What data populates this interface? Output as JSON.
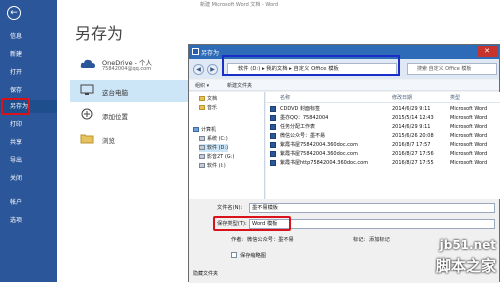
{
  "window_title": "新建 Microsoft Word 文档 - Word",
  "nav": {
    "back": "←",
    "items": [
      "信息",
      "新建",
      "打开",
      "保存",
      "另存为",
      "打印",
      "共享",
      "导出",
      "关闭",
      "帐户",
      "选项"
    ],
    "active": "另存为"
  },
  "page_title": "另存为",
  "places": [
    {
      "name": "OneDrive - 个人",
      "sub": "75842004@qq.com"
    },
    {
      "name": "这台电脑",
      "sub": ""
    },
    {
      "name": "添加位置",
      "sub": ""
    },
    {
      "name": "浏览",
      "sub": ""
    }
  ],
  "dialog": {
    "title": "另存为",
    "close": "✕",
    "address": "软件 (D:) ▸ 我的文档 ▸ 自定义 Office 模板",
    "search_placeholder": "搜索 自定义 Office 模板",
    "toolbar": {
      "organize": "组织 ▾",
      "new_folder": "新建文件夹"
    },
    "tree": [
      "文档",
      "音乐",
      "计算机",
      "系统 (C:)",
      "软件 (D:)",
      "影音2T (G:)",
      "软件 (I:)"
    ],
    "columns": {
      "name": "名称",
      "date": "修改日期",
      "type": "类型"
    },
    "files": [
      {
        "name": "CDDVD 封面标签",
        "date": "2014/6/29 9:11",
        "type": "Microsoft Word"
      },
      {
        "name": "墨亦QQ：75842004",
        "date": "2015/5/14 12:43",
        "type": "Microsoft Word"
      },
      {
        "name": "任务分配工作表",
        "date": "2014/6/29 9:11",
        "type": "Microsoft Word"
      },
      {
        "name": "微信公众号：墨不易",
        "date": "2015/6/26 20:08",
        "type": "Microsoft Word"
      },
      {
        "name": "紫霞书屋75842004.360doc.com",
        "date": "2016/8/7 17:57",
        "type": "Microsoft Word"
      },
      {
        "name": "紫霞书屋75842004.360doc.com",
        "date": "2016/8/27 17:56",
        "type": "Microsoft Word"
      },
      {
        "name": "紫霞书屋http75842004.360doc.com",
        "date": "2016/8/27 17:55",
        "type": "Microsoft Word"
      }
    ],
    "filename_label": "文件名(N):",
    "filename_value": "墨不易模板",
    "filetype_label": "保存类型(T):",
    "filetype_value": "Word 模板",
    "author_label": "作者:",
    "author_value": "微信公众号：墨不易",
    "tags_label": "标记:",
    "tags_value": "添加标记",
    "thumbnail_label": "保存缩略图",
    "hide_folders": "隐藏文件夹"
  },
  "watermark": {
    "line1": "jb51.net",
    "line2": "脚本之家"
  },
  "colors": {
    "nav_bg": "#2b579a",
    "highlight_red": "#d9131c",
    "highlight_blue": "#1a2ec8"
  }
}
